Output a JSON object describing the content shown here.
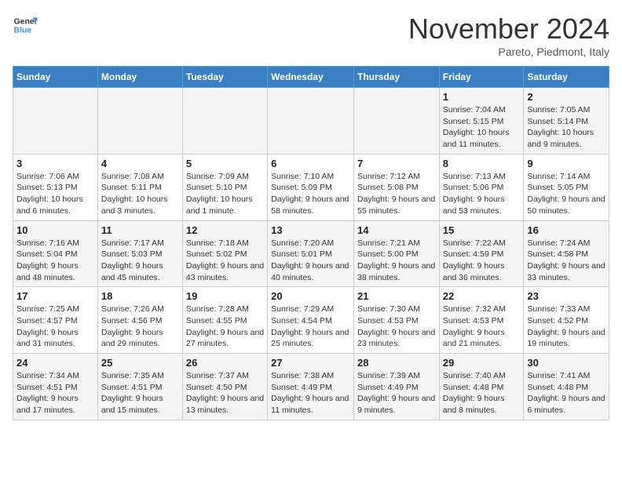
{
  "header": {
    "logo_line1": "General",
    "logo_line2": "Blue",
    "month_title": "November 2024",
    "location": "Pareto, Piedmont, Italy"
  },
  "weekdays": [
    "Sunday",
    "Monday",
    "Tuesday",
    "Wednesday",
    "Thursday",
    "Friday",
    "Saturday"
  ],
  "weeks": [
    [
      {
        "day": "",
        "info": ""
      },
      {
        "day": "",
        "info": ""
      },
      {
        "day": "",
        "info": ""
      },
      {
        "day": "",
        "info": ""
      },
      {
        "day": "",
        "info": ""
      },
      {
        "day": "1",
        "info": "Sunrise: 7:04 AM\nSunset: 5:15 PM\nDaylight: 10 hours and 11 minutes."
      },
      {
        "day": "2",
        "info": "Sunrise: 7:05 AM\nSunset: 5:14 PM\nDaylight: 10 hours and 9 minutes."
      }
    ],
    [
      {
        "day": "3",
        "info": "Sunrise: 7:06 AM\nSunset: 5:13 PM\nDaylight: 10 hours and 6 minutes."
      },
      {
        "day": "4",
        "info": "Sunrise: 7:08 AM\nSunset: 5:11 PM\nDaylight: 10 hours and 3 minutes."
      },
      {
        "day": "5",
        "info": "Sunrise: 7:09 AM\nSunset: 5:10 PM\nDaylight: 10 hours and 1 minute."
      },
      {
        "day": "6",
        "info": "Sunrise: 7:10 AM\nSunset: 5:09 PM\nDaylight: 9 hours and 58 minutes."
      },
      {
        "day": "7",
        "info": "Sunrise: 7:12 AM\nSunset: 5:08 PM\nDaylight: 9 hours and 55 minutes."
      },
      {
        "day": "8",
        "info": "Sunrise: 7:13 AM\nSunset: 5:06 PM\nDaylight: 9 hours and 53 minutes."
      },
      {
        "day": "9",
        "info": "Sunrise: 7:14 AM\nSunset: 5:05 PM\nDaylight: 9 hours and 50 minutes."
      }
    ],
    [
      {
        "day": "10",
        "info": "Sunrise: 7:16 AM\nSunset: 5:04 PM\nDaylight: 9 hours and 48 minutes."
      },
      {
        "day": "11",
        "info": "Sunrise: 7:17 AM\nSunset: 5:03 PM\nDaylight: 9 hours and 45 minutes."
      },
      {
        "day": "12",
        "info": "Sunrise: 7:18 AM\nSunset: 5:02 PM\nDaylight: 9 hours and 43 minutes."
      },
      {
        "day": "13",
        "info": "Sunrise: 7:20 AM\nSunset: 5:01 PM\nDaylight: 9 hours and 40 minutes."
      },
      {
        "day": "14",
        "info": "Sunrise: 7:21 AM\nSunset: 5:00 PM\nDaylight: 9 hours and 38 minutes."
      },
      {
        "day": "15",
        "info": "Sunrise: 7:22 AM\nSunset: 4:59 PM\nDaylight: 9 hours and 36 minutes."
      },
      {
        "day": "16",
        "info": "Sunrise: 7:24 AM\nSunset: 4:58 PM\nDaylight: 9 hours and 33 minutes."
      }
    ],
    [
      {
        "day": "17",
        "info": "Sunrise: 7:25 AM\nSunset: 4:57 PM\nDaylight: 9 hours and 31 minutes."
      },
      {
        "day": "18",
        "info": "Sunrise: 7:26 AM\nSunset: 4:56 PM\nDaylight: 9 hours and 29 minutes."
      },
      {
        "day": "19",
        "info": "Sunrise: 7:28 AM\nSunset: 4:55 PM\nDaylight: 9 hours and 27 minutes."
      },
      {
        "day": "20",
        "info": "Sunrise: 7:29 AM\nSunset: 4:54 PM\nDaylight: 9 hours and 25 minutes."
      },
      {
        "day": "21",
        "info": "Sunrise: 7:30 AM\nSunset: 4:53 PM\nDaylight: 9 hours and 23 minutes."
      },
      {
        "day": "22",
        "info": "Sunrise: 7:32 AM\nSunset: 4:53 PM\nDaylight: 9 hours and 21 minutes."
      },
      {
        "day": "23",
        "info": "Sunrise: 7:33 AM\nSunset: 4:52 PM\nDaylight: 9 hours and 19 minutes."
      }
    ],
    [
      {
        "day": "24",
        "info": "Sunrise: 7:34 AM\nSunset: 4:51 PM\nDaylight: 9 hours and 17 minutes."
      },
      {
        "day": "25",
        "info": "Sunrise: 7:35 AM\nSunset: 4:51 PM\nDaylight: 9 hours and 15 minutes."
      },
      {
        "day": "26",
        "info": "Sunrise: 7:37 AM\nSunset: 4:50 PM\nDaylight: 9 hours and 13 minutes."
      },
      {
        "day": "27",
        "info": "Sunrise: 7:38 AM\nSunset: 4:49 PM\nDaylight: 9 hours and 11 minutes."
      },
      {
        "day": "28",
        "info": "Sunrise: 7:39 AM\nSunset: 4:49 PM\nDaylight: 9 hours and 9 minutes."
      },
      {
        "day": "29",
        "info": "Sunrise: 7:40 AM\nSunset: 4:48 PM\nDaylight: 9 hours and 8 minutes."
      },
      {
        "day": "30",
        "info": "Sunrise: 7:41 AM\nSunset: 4:48 PM\nDaylight: 9 hours and 6 minutes."
      }
    ]
  ]
}
